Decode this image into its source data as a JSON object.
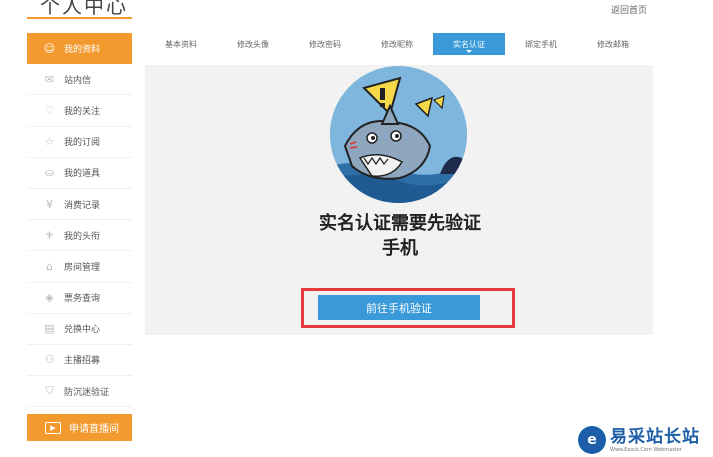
{
  "header": {
    "title": "个人中心",
    "back_home": "返回首页"
  },
  "sidebar": {
    "items": [
      {
        "label": "我的资料",
        "icon": "user-circle-icon",
        "glyph": "☺",
        "active": true
      },
      {
        "label": "站内信",
        "icon": "mail-icon",
        "glyph": "✉"
      },
      {
        "label": "我的关注",
        "icon": "heart-icon",
        "glyph": "♡"
      },
      {
        "label": "我的订阅",
        "icon": "star-icon",
        "glyph": "☆"
      },
      {
        "label": "我的道具",
        "icon": "gift-icon",
        "glyph": "⛀"
      },
      {
        "label": "消费记录",
        "icon": "yen-coin-icon",
        "glyph": "¥"
      },
      {
        "label": "我的头衔",
        "icon": "badge-icon",
        "glyph": "⚜"
      },
      {
        "label": "房间管理",
        "icon": "house-icon",
        "glyph": "⌂"
      },
      {
        "label": "票务查询",
        "icon": "ticket-icon",
        "glyph": "◈"
      },
      {
        "label": "兑换中心",
        "icon": "exchange-icon",
        "glyph": "▤"
      },
      {
        "label": "主播招募",
        "icon": "group-icon",
        "glyph": "⚇"
      },
      {
        "label": "防沉迷验证",
        "icon": "shield-icon",
        "glyph": "⛉"
      }
    ],
    "apply_label": "申请直播间"
  },
  "tabs": [
    {
      "label": "基本资料"
    },
    {
      "label": "修改头像"
    },
    {
      "label": "修改密码"
    },
    {
      "label": "修改昵称"
    },
    {
      "label": "实名认证",
      "active": true
    },
    {
      "label": "绑定手机"
    },
    {
      "label": "修改邮箱"
    }
  ],
  "main": {
    "headline_line1": "实名认证需要先验证",
    "headline_line2": "手机",
    "verify_button": "前往手机验证"
  },
  "watermark": {
    "cn": "易采站长站",
    "en": "Www.Easck.Com Webmaster",
    "logo_letter": "e"
  },
  "colors": {
    "accent_orange": "#f39a2e",
    "accent_blue": "#3a9ad9",
    "highlight_red": "#e53a3a"
  }
}
